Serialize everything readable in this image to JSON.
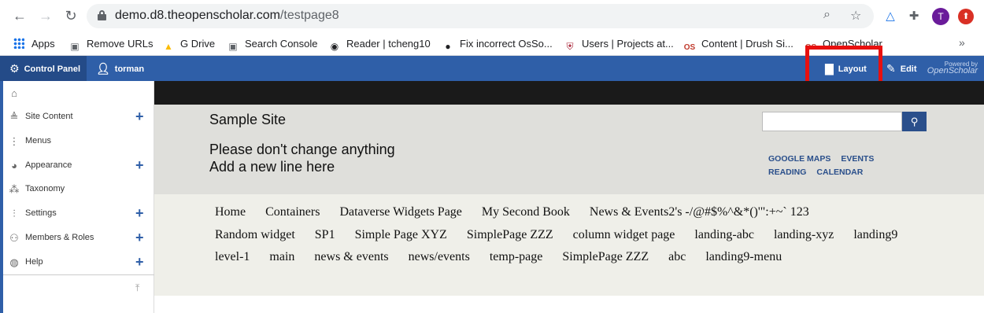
{
  "browser": {
    "url_host": "demo.d8.theopenscholar.com",
    "url_path": "/testpage8",
    "profile_initial": "T"
  },
  "bookmarks": [
    {
      "label": "Apps",
      "icon": "apps-grid-icon"
    },
    {
      "label": "Remove URLs",
      "icon": "search-console-icon"
    },
    {
      "label": "G Drive",
      "icon": "google-drive-icon"
    },
    {
      "label": "Search Console",
      "icon": "search-console-icon"
    },
    {
      "label": "Reader | tcheng10",
      "icon": "globe-icon"
    },
    {
      "label": "Fix incorrect OsSo...",
      "icon": "github-icon"
    },
    {
      "label": "Users | Projects at...",
      "icon": "harvard-shield-icon"
    },
    {
      "label": "Content | Drush Si...",
      "icon": "openscholar-icon"
    },
    {
      "label": "OpenScholar",
      "icon": "openscholar-icon"
    }
  ],
  "admin_bar": {
    "control_panel": "Control Panel",
    "user": "torman",
    "layout": "Layout",
    "edit": "Edit",
    "powered_by": "Powered by",
    "powered_brand": "OpenScholar"
  },
  "sidebar": {
    "items": [
      {
        "label": "",
        "icon": "home-icon",
        "expandable": false
      },
      {
        "label": "Site Content",
        "icon": "content-icon",
        "expandable": true
      },
      {
        "label": "Menus",
        "icon": "menu-dots-icon",
        "expandable": false
      },
      {
        "label": "Appearance",
        "icon": "palette-icon",
        "expandable": true
      },
      {
        "label": "Taxonomy",
        "icon": "taxonomy-icon",
        "expandable": false
      },
      {
        "label": "Settings",
        "icon": "sliders-icon",
        "expandable": true
      },
      {
        "label": "Members & Roles",
        "icon": "members-icon",
        "expandable": true
      },
      {
        "label": "Help",
        "icon": "help-icon",
        "expandable": true
      }
    ]
  },
  "site": {
    "title": "Sample Site",
    "description_line1": "Please don't change anything",
    "description_line2": "Add a new line here",
    "header_links": [
      "GOOGLE MAPS",
      "EVENTS",
      "READING",
      "CALENDAR"
    ]
  },
  "menu_items": [
    "Home",
    "Containers",
    "Dataverse Widgets Page",
    "My Second Book",
    "News & Events2's -/@#$%^&*()'\":+~` 123",
    "Random widget",
    "SP1",
    "Simple Page XYZ",
    "SimplePage ZZZ",
    "column widget page",
    "landing-abc",
    "landing-xyz",
    "landing9",
    "level-1",
    "main",
    "news & events",
    "news/events",
    "temp-page",
    "SimplePage ZZZ",
    "abc",
    "landing9-menu"
  ],
  "colors": {
    "admin_bar": "#2f5fa8",
    "highlight_box": "#e8100f",
    "link_blue": "#2a4f8b"
  }
}
